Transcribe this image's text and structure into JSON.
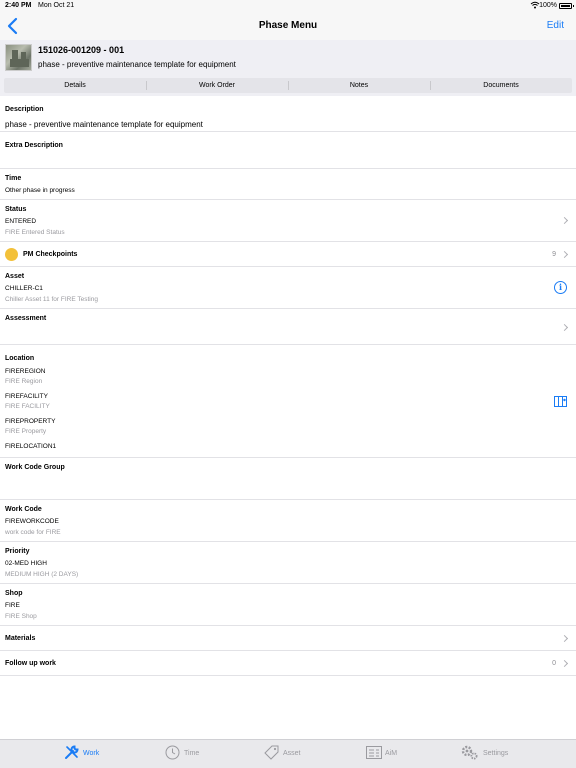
{
  "status_bar": {
    "time": "2:40 PM",
    "date": "Mon Oct 21",
    "battery": "100%",
    "battery_level": 1.0
  },
  "nav": {
    "title": "Phase Menu",
    "edit_label": "Edit"
  },
  "header": {
    "work_order": "151026-001209 - 001",
    "description": "phase - preventive maintenance template for equipment"
  },
  "tabs": [
    "Details",
    "Work Order",
    "Notes",
    "Documents"
  ],
  "details": {
    "description_label": "Description",
    "description_value": "phase - preventive maintenance template for equipment",
    "extra_description_label": "Extra Description",
    "time_label": "Time",
    "time_value": "Other phase in progress",
    "status_label": "Status",
    "status_value": "ENTERED",
    "status_sub": "FIRE Entered Status",
    "pm_label": "PM Checkpoints",
    "pm_count": "9",
    "asset_label": "Asset",
    "asset_value": "CHILLER-C1",
    "asset_sub": "Chiller Asset 11 for FIRE Testing",
    "assessment_label": "Assessment",
    "location_label": "Location",
    "region_value": "FIREREGION",
    "region_sub": "FIRE Region",
    "facility_value": "FIREFACILITY",
    "facility_sub": "FIRE FACILITY",
    "property_value": "FIREPROPERTY",
    "property_sub": "FIRE Property",
    "location_value": "FIRELOCATION1",
    "work_code_group_label": "Work Code Group",
    "work_code_label": "Work Code",
    "work_code_value": "FIREWORKCODE",
    "work_code_sub": "work code for FIRE",
    "priority_label": "Priority",
    "priority_value": "02-MED HIGH",
    "priority_sub": "MEDIUM HIGH (2 DAYS)",
    "shop_label": "Shop",
    "shop_value": "FIRE",
    "shop_sub": "FIRE Shop",
    "materials_label": "Materials",
    "follow_up_label": "Follow up work",
    "follow_up_count": "0"
  },
  "tab_bar": [
    {
      "label": "Work",
      "icon": "wrench-icon",
      "active": true
    },
    {
      "label": "Time",
      "icon": "clock-icon",
      "active": false
    },
    {
      "label": "Asset",
      "icon": "tag-icon",
      "active": false
    },
    {
      "label": "AiM",
      "icon": "aim-icon",
      "active": false
    },
    {
      "label": "Settings",
      "icon": "gear-icon",
      "active": false
    }
  ],
  "colors": {
    "accent": "#1a7cf5",
    "pm_dot": "#f3c13a",
    "header_bg": "#efeff4"
  }
}
